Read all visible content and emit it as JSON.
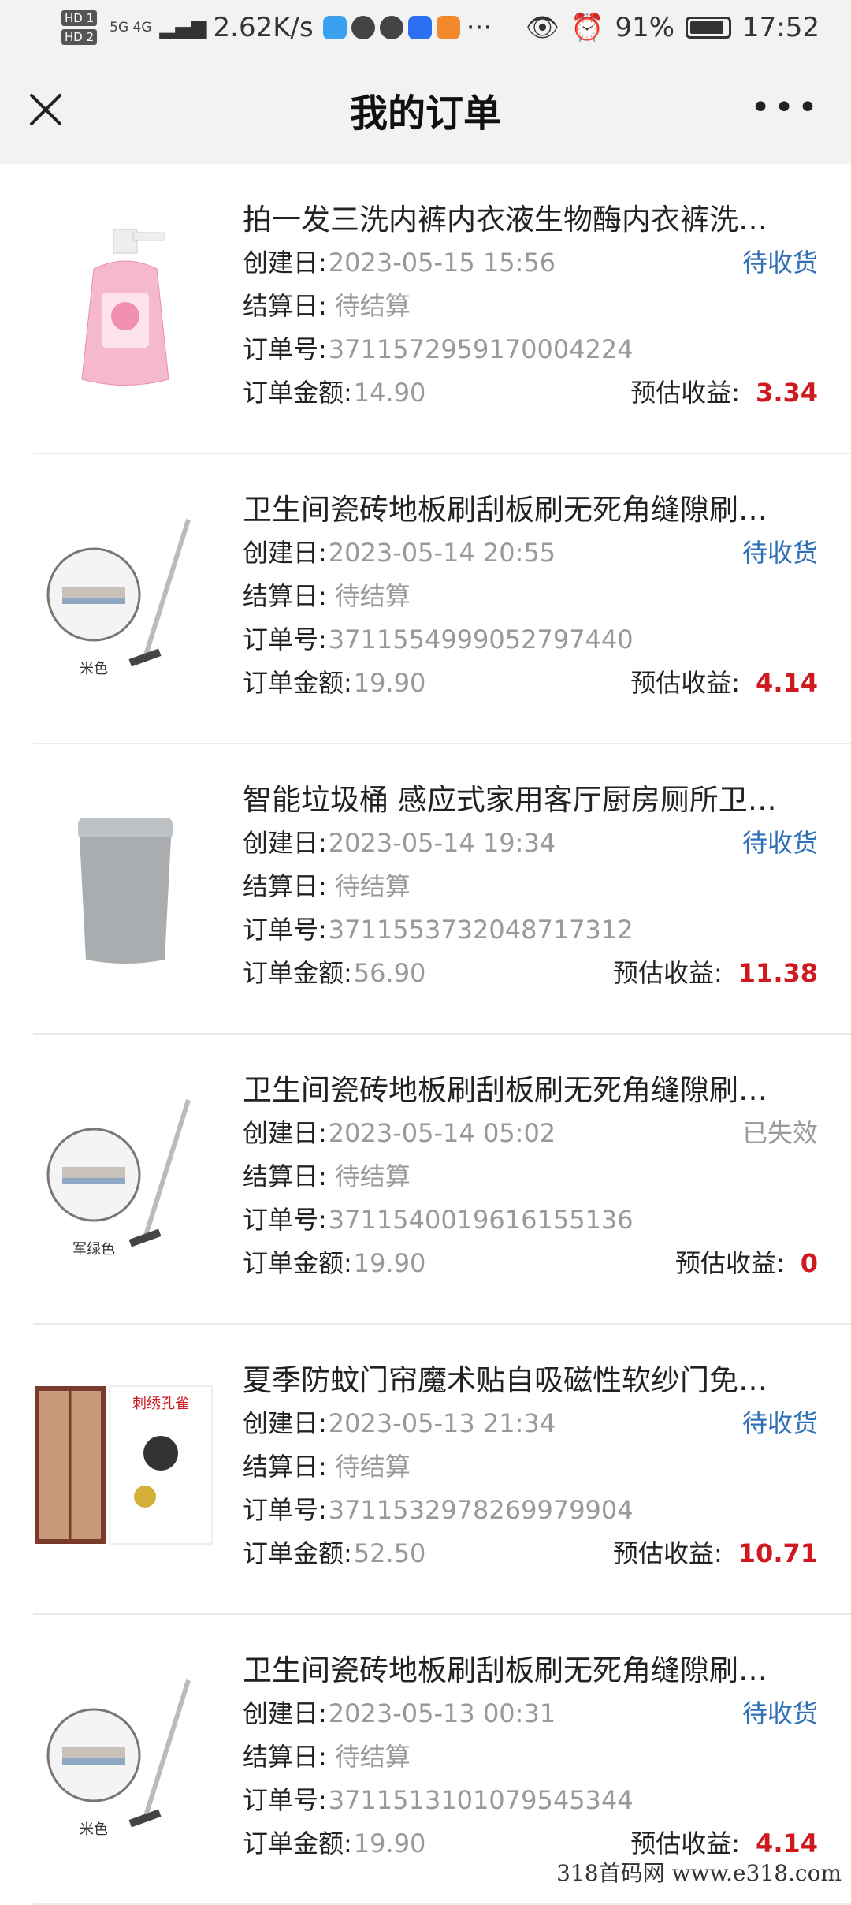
{
  "status_bar": {
    "hd1": "HD 1",
    "hd2": "HD 2",
    "net": "5G 4G",
    "speed": "2.62K/s",
    "battery": "91%",
    "time": "17:52",
    "dots": "···"
  },
  "header": {
    "title": "我的订单",
    "more": "•••"
  },
  "labels": {
    "created": "创建日:",
    "settled": "结算日:",
    "order_no": "订单号:",
    "amount": "订单金额:",
    "estimate": "预估收益:"
  },
  "orders": [
    {
      "name": "拍一发三洗内裤内衣液生物酶内衣裤洗…",
      "created": "2023-05-15 15:56",
      "status": "待收货",
      "settled": "待结算",
      "order_no": "3711572959170004224",
      "amount": "14.90",
      "estimate": "3.34",
      "thumb": "detergent-bottle",
      "thumb_caption": ""
    },
    {
      "name": "卫生间瓷砖地板刷刮板刷无死角缝隙刷…",
      "created": "2023-05-14 20:55",
      "status": "待收货",
      "settled": "待结算",
      "order_no": "3711554999052797440",
      "amount": "19.90",
      "estimate": "4.14",
      "thumb": "floor-brush",
      "thumb_caption": "米色"
    },
    {
      "name": "智能垃圾桶 感应式家用客厅厨房厕所卫…",
      "created": "2023-05-14 19:34",
      "status": "待收货",
      "settled": "待结算",
      "order_no": "3711553732048717312",
      "amount": "56.90",
      "estimate": "11.38",
      "thumb": "trash-bin",
      "thumb_caption": ""
    },
    {
      "name": "卫生间瓷砖地板刷刮板刷无死角缝隙刷…",
      "created": "2023-05-14 05:02",
      "status": "已失效",
      "settled": "待结算",
      "order_no": "3711540019616155136",
      "amount": "19.90",
      "estimate": "0",
      "thumb": "floor-brush",
      "thumb_caption": "军绿色"
    },
    {
      "name": "夏季防蚊门帘魔术贴自吸磁性软纱门免…",
      "created": "2023-05-13 21:34",
      "status": "待收货",
      "settled": "待结算",
      "order_no": "3711532978269979904",
      "amount": "52.50",
      "estimate": "10.71",
      "thumb": "door-curtain",
      "thumb_caption": "刺绣孔雀"
    },
    {
      "name": "卫生间瓷砖地板刷刮板刷无死角缝隙刷…",
      "created": "2023-05-13 00:31",
      "status": "待收货",
      "settled": "待结算",
      "order_no": "3711513101079545344",
      "amount": "19.90",
      "estimate": "4.14",
      "thumb": "floor-brush",
      "thumb_caption": "米色"
    }
  ],
  "watermark": "318首码网  www.e318.com",
  "colors": {
    "status_blue": "#2f6fb5",
    "estimate_red": "#d0191f",
    "muted": "#999999"
  }
}
